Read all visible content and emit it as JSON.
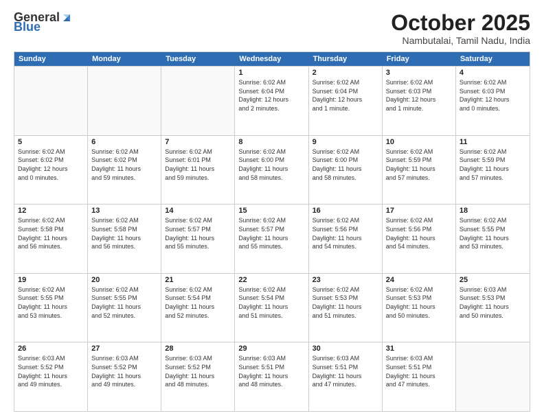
{
  "header": {
    "logo_general": "General",
    "logo_blue": "Blue",
    "month_title": "October 2025",
    "location": "Nambutalai, Tamil Nadu, India"
  },
  "calendar": {
    "days_of_week": [
      "Sunday",
      "Monday",
      "Tuesday",
      "Wednesday",
      "Thursday",
      "Friday",
      "Saturday"
    ],
    "weeks": [
      [
        {
          "day": "",
          "lines": []
        },
        {
          "day": "",
          "lines": []
        },
        {
          "day": "",
          "lines": []
        },
        {
          "day": "1",
          "lines": [
            "Sunrise: 6:02 AM",
            "Sunset: 6:04 PM",
            "Daylight: 12 hours",
            "and 2 minutes."
          ]
        },
        {
          "day": "2",
          "lines": [
            "Sunrise: 6:02 AM",
            "Sunset: 6:04 PM",
            "Daylight: 12 hours",
            "and 1 minute."
          ]
        },
        {
          "day": "3",
          "lines": [
            "Sunrise: 6:02 AM",
            "Sunset: 6:03 PM",
            "Daylight: 12 hours",
            "and 1 minute."
          ]
        },
        {
          "day": "4",
          "lines": [
            "Sunrise: 6:02 AM",
            "Sunset: 6:03 PM",
            "Daylight: 12 hours",
            "and 0 minutes."
          ]
        }
      ],
      [
        {
          "day": "5",
          "lines": [
            "Sunrise: 6:02 AM",
            "Sunset: 6:02 PM",
            "Daylight: 12 hours",
            "and 0 minutes."
          ]
        },
        {
          "day": "6",
          "lines": [
            "Sunrise: 6:02 AM",
            "Sunset: 6:02 PM",
            "Daylight: 11 hours",
            "and 59 minutes."
          ]
        },
        {
          "day": "7",
          "lines": [
            "Sunrise: 6:02 AM",
            "Sunset: 6:01 PM",
            "Daylight: 11 hours",
            "and 59 minutes."
          ]
        },
        {
          "day": "8",
          "lines": [
            "Sunrise: 6:02 AM",
            "Sunset: 6:00 PM",
            "Daylight: 11 hours",
            "and 58 minutes."
          ]
        },
        {
          "day": "9",
          "lines": [
            "Sunrise: 6:02 AM",
            "Sunset: 6:00 PM",
            "Daylight: 11 hours",
            "and 58 minutes."
          ]
        },
        {
          "day": "10",
          "lines": [
            "Sunrise: 6:02 AM",
            "Sunset: 5:59 PM",
            "Daylight: 11 hours",
            "and 57 minutes."
          ]
        },
        {
          "day": "11",
          "lines": [
            "Sunrise: 6:02 AM",
            "Sunset: 5:59 PM",
            "Daylight: 11 hours",
            "and 57 minutes."
          ]
        }
      ],
      [
        {
          "day": "12",
          "lines": [
            "Sunrise: 6:02 AM",
            "Sunset: 5:58 PM",
            "Daylight: 11 hours",
            "and 56 minutes."
          ]
        },
        {
          "day": "13",
          "lines": [
            "Sunrise: 6:02 AM",
            "Sunset: 5:58 PM",
            "Daylight: 11 hours",
            "and 56 minutes."
          ]
        },
        {
          "day": "14",
          "lines": [
            "Sunrise: 6:02 AM",
            "Sunset: 5:57 PM",
            "Daylight: 11 hours",
            "and 55 minutes."
          ]
        },
        {
          "day": "15",
          "lines": [
            "Sunrise: 6:02 AM",
            "Sunset: 5:57 PM",
            "Daylight: 11 hours",
            "and 55 minutes."
          ]
        },
        {
          "day": "16",
          "lines": [
            "Sunrise: 6:02 AM",
            "Sunset: 5:56 PM",
            "Daylight: 11 hours",
            "and 54 minutes."
          ]
        },
        {
          "day": "17",
          "lines": [
            "Sunrise: 6:02 AM",
            "Sunset: 5:56 PM",
            "Daylight: 11 hours",
            "and 54 minutes."
          ]
        },
        {
          "day": "18",
          "lines": [
            "Sunrise: 6:02 AM",
            "Sunset: 5:55 PM",
            "Daylight: 11 hours",
            "and 53 minutes."
          ]
        }
      ],
      [
        {
          "day": "19",
          "lines": [
            "Sunrise: 6:02 AM",
            "Sunset: 5:55 PM",
            "Daylight: 11 hours",
            "and 53 minutes."
          ]
        },
        {
          "day": "20",
          "lines": [
            "Sunrise: 6:02 AM",
            "Sunset: 5:55 PM",
            "Daylight: 11 hours",
            "and 52 minutes."
          ]
        },
        {
          "day": "21",
          "lines": [
            "Sunrise: 6:02 AM",
            "Sunset: 5:54 PM",
            "Daylight: 11 hours",
            "and 52 minutes."
          ]
        },
        {
          "day": "22",
          "lines": [
            "Sunrise: 6:02 AM",
            "Sunset: 5:54 PM",
            "Daylight: 11 hours",
            "and 51 minutes."
          ]
        },
        {
          "day": "23",
          "lines": [
            "Sunrise: 6:02 AM",
            "Sunset: 5:53 PM",
            "Daylight: 11 hours",
            "and 51 minutes."
          ]
        },
        {
          "day": "24",
          "lines": [
            "Sunrise: 6:02 AM",
            "Sunset: 5:53 PM",
            "Daylight: 11 hours",
            "and 50 minutes."
          ]
        },
        {
          "day": "25",
          "lines": [
            "Sunrise: 6:03 AM",
            "Sunset: 5:53 PM",
            "Daylight: 11 hours",
            "and 50 minutes."
          ]
        }
      ],
      [
        {
          "day": "26",
          "lines": [
            "Sunrise: 6:03 AM",
            "Sunset: 5:52 PM",
            "Daylight: 11 hours",
            "and 49 minutes."
          ]
        },
        {
          "day": "27",
          "lines": [
            "Sunrise: 6:03 AM",
            "Sunset: 5:52 PM",
            "Daylight: 11 hours",
            "and 49 minutes."
          ]
        },
        {
          "day": "28",
          "lines": [
            "Sunrise: 6:03 AM",
            "Sunset: 5:52 PM",
            "Daylight: 11 hours",
            "and 48 minutes."
          ]
        },
        {
          "day": "29",
          "lines": [
            "Sunrise: 6:03 AM",
            "Sunset: 5:51 PM",
            "Daylight: 11 hours",
            "and 48 minutes."
          ]
        },
        {
          "day": "30",
          "lines": [
            "Sunrise: 6:03 AM",
            "Sunset: 5:51 PM",
            "Daylight: 11 hours",
            "and 47 minutes."
          ]
        },
        {
          "day": "31",
          "lines": [
            "Sunrise: 6:03 AM",
            "Sunset: 5:51 PM",
            "Daylight: 11 hours",
            "and 47 minutes."
          ]
        },
        {
          "day": "",
          "lines": []
        }
      ]
    ]
  }
}
